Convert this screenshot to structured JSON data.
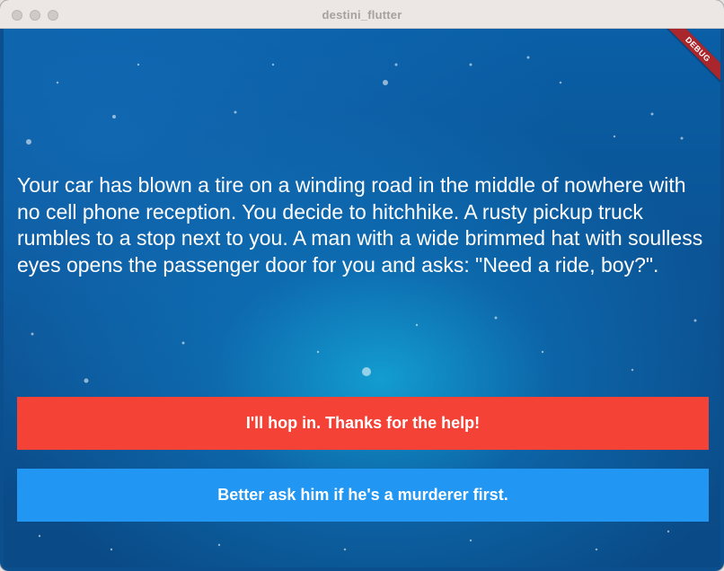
{
  "window": {
    "title": "destini_flutter"
  },
  "debug_banner": {
    "label": "DEBUG",
    "color": "#a8262c"
  },
  "story": {
    "text": "Your car has blown a tire on a winding road in the middle of nowhere with no cell phone reception. You decide to hitchhike. A rusty pickup truck rumbles to a stop next to you. A man with a wide brimmed hat with soulless eyes opens the passenger door for you and asks: \"Need a ride, boy?\"."
  },
  "choices": [
    {
      "label": "I'll hop in. Thanks for the help!",
      "color": "#f44236"
    },
    {
      "label": "Better ask him if he's a murderer first.",
      "color": "#2196f2"
    }
  ],
  "colors": {
    "background": "#0b4f8f",
    "text": "#ffffff"
  }
}
